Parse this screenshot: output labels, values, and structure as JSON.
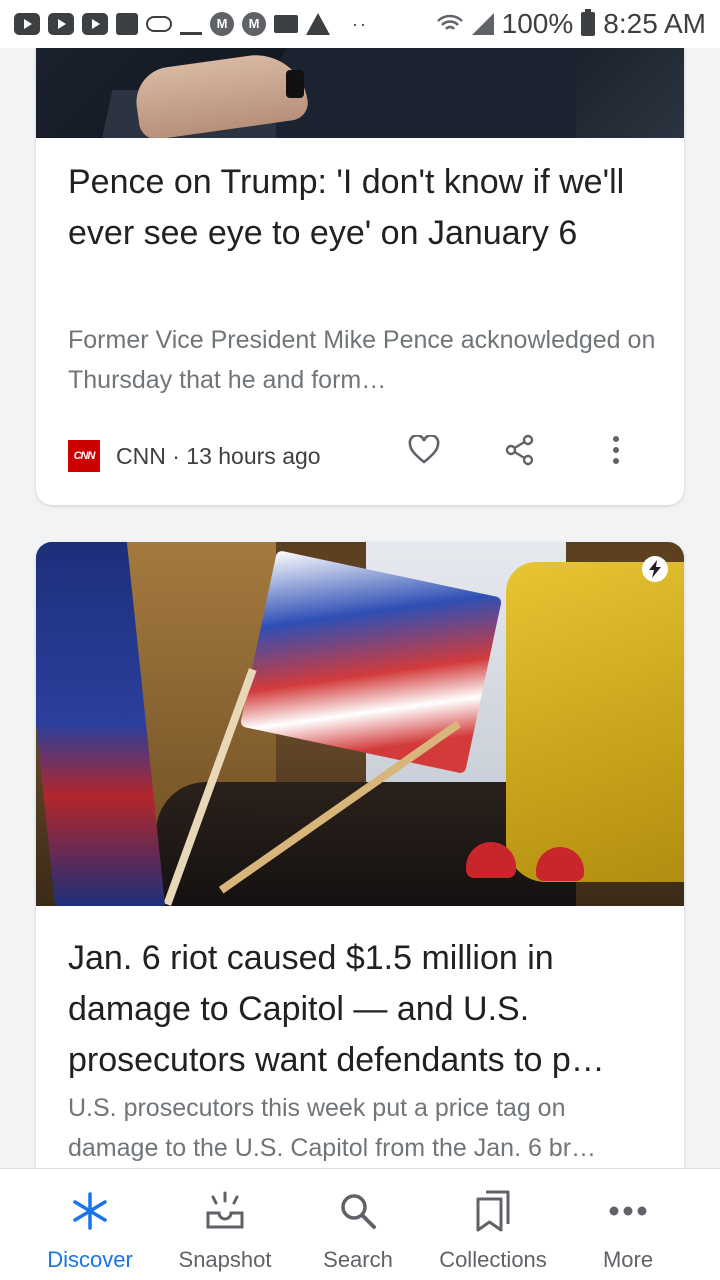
{
  "status_bar": {
    "notification_icons": [
      "youtube-icon",
      "youtube-icon",
      "youtube-icon",
      "chat-icon",
      "cloud-icon",
      "crown-icon",
      "m-app-icon",
      "m-app-icon",
      "folder-icon",
      "warning-icon"
    ],
    "overflow_dots": "··",
    "battery": "100%",
    "time": "8:25 AM"
  },
  "feed": {
    "cards": [
      {
        "title": "Pence on Trump: 'I don't know if we'll ever see eye to eye' on January 6",
        "snippet": "Former Vice President Mike Pence acknowledged on Thursday that he and form…",
        "source_logo": "CNN",
        "source": "CNN",
        "separator": "·",
        "time": "13 hours ago"
      },
      {
        "title": "Jan. 6 riot caused $1.5 million in damage to Capitol — and U.S. prosecutors want defendants to p…",
        "snippet": "U.S. prosecutors this week put a price tag on damage to the U.S. Capitol from the Jan. 6 br…",
        "amp_badge": "lightning-icon"
      }
    ]
  },
  "bottom_nav": {
    "items": [
      {
        "label": "Discover",
        "icon": "asterisk-icon",
        "active": true
      },
      {
        "label": "Snapshot",
        "icon": "snapshot-icon",
        "active": false
      },
      {
        "label": "Search",
        "icon": "search-icon",
        "active": false
      },
      {
        "label": "Collections",
        "icon": "collections-icon",
        "active": false
      },
      {
        "label": "More",
        "icon": "more-icon",
        "active": false
      }
    ]
  },
  "colors": {
    "accent": "#1a73e8",
    "cnn_red": "#cc0000",
    "title_text": "#202124",
    "snippet_text": "#70757a"
  }
}
